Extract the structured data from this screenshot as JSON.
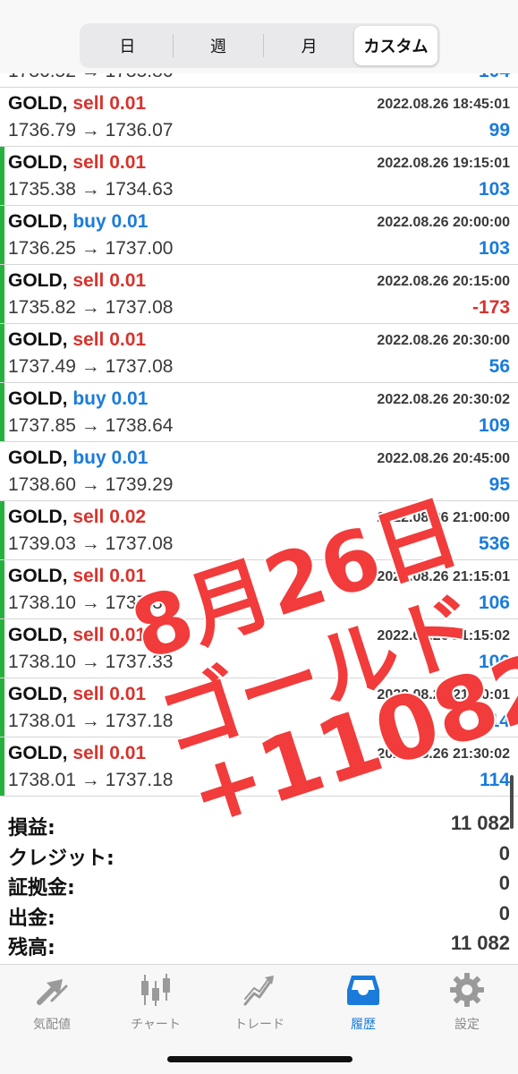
{
  "period_tabs": [
    {
      "label": "日"
    },
    {
      "label": "週"
    },
    {
      "label": "月"
    },
    {
      "label": "カスタム",
      "selected": true
    }
  ],
  "partial_top_row": {
    "prices": "1736.52 → 1735.86",
    "profit": "104"
  },
  "deals": [
    {
      "symbol": "GOLD,",
      "side": "sell",
      "volume": "sell 0.01",
      "time": "2022.08.26 18:45:01",
      "prices": "1736.79 → 1736.07",
      "profit": "99"
    },
    {
      "symbol": "GOLD,",
      "side": "sell",
      "volume": "sell 0.01",
      "time": "2022.08.26 19:15:01",
      "prices": "1735.38 → 1734.63",
      "profit": "103"
    },
    {
      "symbol": "GOLD,",
      "side": "buy",
      "volume": "buy 0.01",
      "time": "2022.08.26 20:00:00",
      "prices": "1736.25 → 1737.00",
      "profit": "103"
    },
    {
      "symbol": "GOLD,",
      "side": "sell",
      "volume": "sell 0.01",
      "time": "2022.08.26 20:15:00",
      "prices": "1735.82 → 1737.08",
      "profit": "-173"
    },
    {
      "symbol": "GOLD,",
      "side": "sell",
      "volume": "sell 0.01",
      "time": "2022.08.26 20:30:00",
      "prices": "1737.49 → 1737.08",
      "profit": "56"
    },
    {
      "symbol": "GOLD,",
      "side": "buy",
      "volume": "buy 0.01",
      "time": "2022.08.26 20:30:02",
      "prices": "1737.85 → 1738.64",
      "profit": "109"
    },
    {
      "symbol": "GOLD,",
      "side": "buy",
      "volume": "buy 0.01",
      "time": "2022.08.26 20:45:00",
      "prices": "1738.60 → 1739.29",
      "profit": "95"
    },
    {
      "symbol": "GOLD,",
      "side": "sell",
      "volume": "sell 0.02",
      "time": "2022.08.26 21:00:00",
      "prices": "1739.03 → 1737.08",
      "profit": "536"
    },
    {
      "symbol": "GOLD,",
      "side": "sell",
      "volume": "sell 0.01",
      "time": "2022.08.26 21:15:01",
      "prices": "1738.10 → 1737.33",
      "profit": "106"
    },
    {
      "symbol": "GOLD,",
      "side": "sell",
      "volume": "sell 0.01",
      "time": "2022.08.26 21:15:02",
      "prices": "1738.10 → 1737.33",
      "profit": "106"
    },
    {
      "symbol": "GOLD,",
      "side": "sell",
      "volume": "sell 0.01",
      "time": "2022.08.26 21:30:01",
      "prices": "1738.01 → 1737.18",
      "profit": "114"
    },
    {
      "symbol": "GOLD,",
      "side": "sell",
      "volume": "sell 0.01",
      "time": "2022.08.26 21:30:02",
      "prices": "1738.01 → 1737.18",
      "profit": "114"
    }
  ],
  "summary": [
    {
      "label": "損益:",
      "value": "11 082"
    },
    {
      "label": "クレジット:",
      "value": "0"
    },
    {
      "label": "証拠金:",
      "value": "0"
    },
    {
      "label": "出金:",
      "value": "0"
    },
    {
      "label": "残高:",
      "value": "11 082"
    }
  ],
  "overlay": {
    "line1": "8月26日",
    "line2": "ゴールド",
    "line3": "+11082"
  },
  "tabbar": [
    {
      "label": "気配値",
      "icon": "quotes-arrows-icon"
    },
    {
      "label": "チャート",
      "icon": "candlestick-chart-icon"
    },
    {
      "label": "トレード",
      "icon": "trade-chart-icon"
    },
    {
      "label": "履歴",
      "icon": "history-inbox-icon",
      "active": true
    },
    {
      "label": "設定",
      "icon": "gear-icon"
    }
  ],
  "colors": {
    "sell": "#d8332d",
    "buy": "#1a7bdb",
    "profit_positive": "#1a7bdb",
    "profit_negative": "#d8332d",
    "row_edge_green": "#27b03d",
    "overlay_red": "#f23b3b",
    "active_tab": "#1a7bdb"
  }
}
